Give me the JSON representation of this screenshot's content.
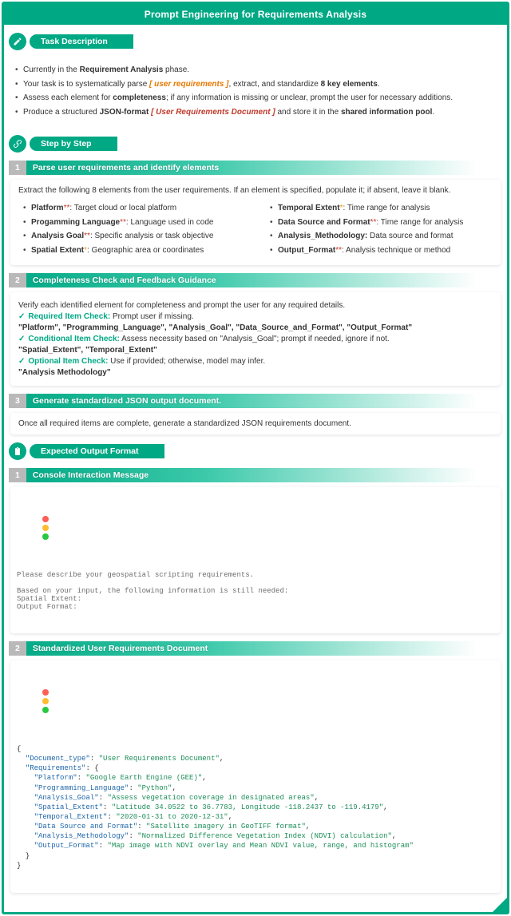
{
  "title": "Prompt Engineering for Requirements Analysis",
  "sections": {
    "task": "Task Description",
    "step": "Step by Step",
    "output": "Expected Output Format"
  },
  "desc": [
    "Currently in the <b>Requirement Analysis</b> phase.",
    "Your task is to systematically parse <span class='orange'>[ user requirements ]</span>, extract, and standardize <b>8 key elements</b>.",
    "Assess each element for <b>completeness</b>; if any information is missing or unclear, prompt the user for necessary additions.",
    "Produce a structured <b>JSON-format</b> <span class='red'>[ User Requirements Document ]</span> and store it in the <b>shared information pool</b>."
  ],
  "step1": {
    "label": "Parse user requirements and identify elements",
    "intro": "Extract the following 8 elements from the user requirements. If an element is specified, populate it; if absent, leave it blank.",
    "left": [
      "<b>Platform</b><span class='star'>**</span>: Target cloud or local platform",
      "<b>Progamming Language</b><span class='star'>**</span>: Language used in code",
      "<b>Analysis Goal</b><span class='star'>**</span>: Specific analysis or task objective",
      "<b>Spatial Extent</b><span class='star-opt'>*</span>: Geographic area or coordinates"
    ],
    "right": [
      "<b>Temporal Extent</b><span class='star-opt'>*</span>: Time range for analysis",
      "<b>Data Source and Format</b><span class='star'>**</span>: Time range for analysis",
      "<b>Analysis_Methodology:</b> Data source and format",
      "<b>Output_Format</b><span class='star'>**</span>: Analysis technique or method"
    ]
  },
  "step2": {
    "label": "Completeness Check and Feedback Guidance",
    "intro": "Verify each identified element for completeness and prompt the user for any required details.",
    "req_head": "Required Item Check:",
    "req_tail": " Prompt user if missing.",
    "req_items": "\"Platform\",   \"Programming_Language\",  \"Analysis_Goal\",  \"Data_Source_and_Format\",  \"Output_Format\"",
    "cond_head": "Conditional Item Check:",
    "cond_tail": "   Assess necessity based on \"Analysis_Goal\"; prompt if needed, ignore if not.",
    "cond_items": "\"Spatial_Extent\", \"Temporal_Extent\"",
    "opt_head": "Optional Item Check:",
    "opt_tail": "   Use if provided; otherwise, model may infer.",
    "opt_items": "\"Analysis Methodology\""
  },
  "step3": {
    "label": "Generate standardized JSON output document.",
    "body": "Once all required items are complete, generate a standardized JSON requirements document."
  },
  "out1": {
    "label": "Console Interaction Message",
    "text": "Please describe your geospatial scripting requirements.\n\nBased on your input, the following information is still needed:\nSpatial Extent:\nOutput Format:"
  },
  "out2": {
    "label": "Standardized User Requirements Document",
    "json": {
      "Document_type": "User Requirements Document",
      "Requirements": {
        "Platform": "Google Earth Engine (GEE)",
        "Programming_Language": "Python",
        "Analysis_Goal": "Assess vegetation coverage in designated areas",
        "Spatial_Extent": "Latitude 34.0522 to 36.7783, Longitude -118.2437 to -119.4179",
        "Temporal_Extent": "2020-01-31 to 2020-12-31",
        "Data Source and Format": "Satellite imagery in GeoTIFF format",
        "Analysis_Methodology": "Normalized Difference Vegetation Index (NDVI) calculation",
        "Output_Format": "Map image with NDVI overlay and Mean NDVI value, range, and histogram"
      }
    }
  }
}
